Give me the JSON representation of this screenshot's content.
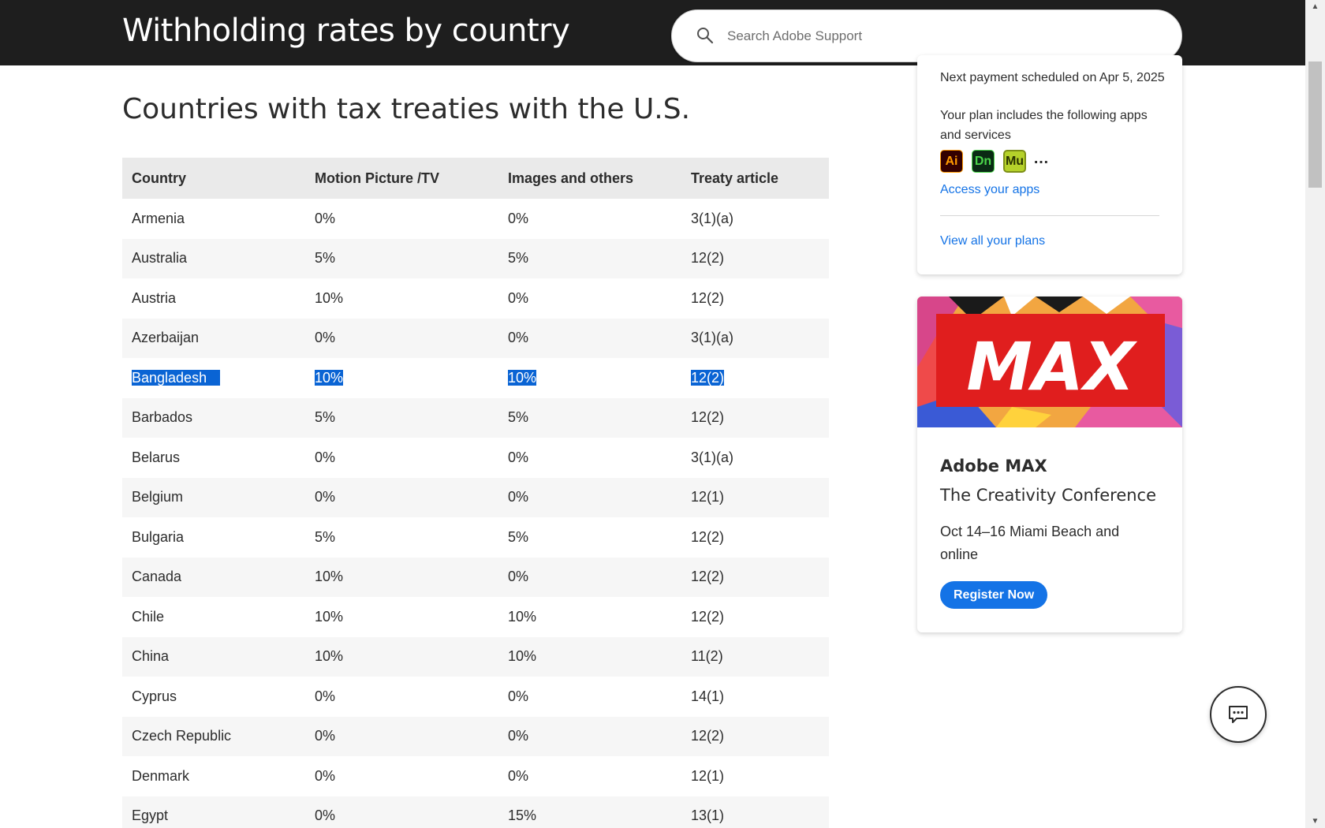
{
  "header": {
    "title": "Withholding rates by country",
    "search_placeholder": "Search Adobe Support",
    "search_icon": "search-icon"
  },
  "main": {
    "heading": "Countries with tax treaties with the U.S.",
    "table": {
      "columns": [
        "Country",
        "Motion Picture /TV",
        "Images and others",
        "Treaty article"
      ],
      "rows": [
        [
          "Armenia",
          "0%",
          "0%",
          "3(1)(a)"
        ],
        [
          "Australia",
          "5%",
          "5%",
          "12(2)"
        ],
        [
          "Austria",
          "10%",
          "0%",
          "12(2)"
        ],
        [
          "Azerbaijan",
          "0%",
          "0%",
          "3(1)(a)"
        ],
        [
          "Bangladesh",
          "10%",
          "10%",
          "12(2)"
        ],
        [
          "Barbados",
          "5%",
          "5%",
          "12(2)"
        ],
        [
          "Belarus",
          "0%",
          "0%",
          "3(1)(a)"
        ],
        [
          "Belgium",
          "0%",
          "0%",
          "12(1)"
        ],
        [
          "Bulgaria",
          "5%",
          "5%",
          "12(2)"
        ],
        [
          "Canada",
          "10%",
          "0%",
          "12(2)"
        ],
        [
          "Chile",
          "10%",
          "10%",
          "12(2)"
        ],
        [
          "China",
          "10%",
          "10%",
          "11(2)"
        ],
        [
          "Cyprus",
          "0%",
          "0%",
          "14(1)"
        ],
        [
          "Czech Republic",
          "0%",
          "0%",
          "12(2)"
        ],
        [
          "Denmark",
          "0%",
          "0%",
          "12(1)"
        ],
        [
          "Egypt",
          "0%",
          "15%",
          "13(1)"
        ]
      ],
      "selected_row_index": 4
    }
  },
  "sidebar": {
    "plan_card": {
      "next_payment": "Next payment scheduled on Apr 5, 2025",
      "plan_includes": "Your plan includes the following apps and services",
      "apps": [
        {
          "label": "Ai",
          "icon": "illustrator-icon"
        },
        {
          "label": "Dn",
          "icon": "dimension-icon"
        },
        {
          "label": "Mu",
          "icon": "muse-icon"
        }
      ],
      "more": "…",
      "access_link": "Access your apps",
      "view_plans_link": "View all your plans"
    },
    "max_card": {
      "banner_text": "MAX",
      "title": "Adobe MAX",
      "subtitle": "The Creativity Conference",
      "dates": "Oct 14–16 Miami Beach and online",
      "button": "Register Now"
    }
  },
  "colors": {
    "header_bg": "#1e1e1e",
    "link": "#1473e6",
    "selection": "#0a64d4",
    "button": "#1473e6",
    "max_red": "#e01e1e"
  },
  "chat_button_icon": "chat-icon"
}
